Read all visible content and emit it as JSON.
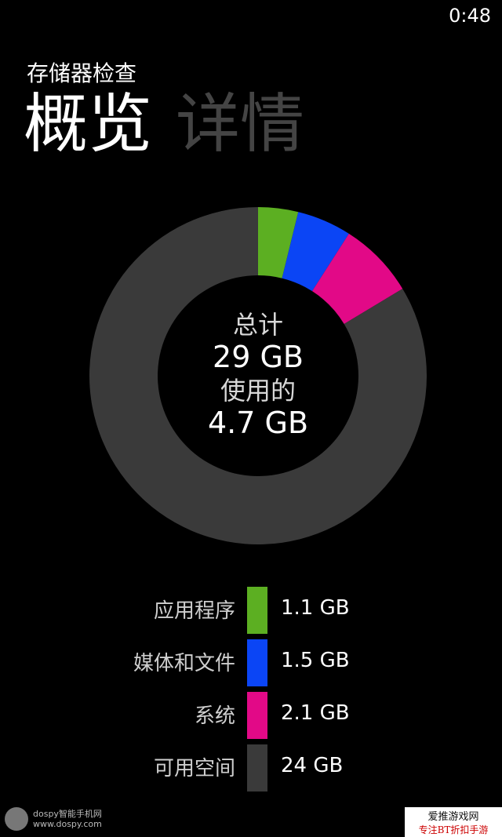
{
  "status_bar": {
    "time": "0:48"
  },
  "app_title": "存储器检查",
  "pivot": {
    "active": "概览",
    "inactive": "详情"
  },
  "donut": {
    "total_label": "总计",
    "total_value": "29 GB",
    "used_label": "使用的",
    "used_value": "4.7 GB"
  },
  "chart_data": {
    "type": "pie",
    "donut": true,
    "segments": [
      {
        "label": "应用程序",
        "value": 1.1,
        "color": "#5CAF22"
      },
      {
        "label": "媒体和文件",
        "value": 1.5,
        "color": "#0B45F5"
      },
      {
        "label": "系统",
        "value": 2.1,
        "color": "#E20987"
      },
      {
        "label": "可用空间",
        "value": 24,
        "color": "#3A3A3A"
      }
    ]
  },
  "legend": [
    {
      "label": "应用程序",
      "value": "1.1 GB",
      "color": "#5CAF22"
    },
    {
      "label": "媒体和文件",
      "value": "1.5 GB",
      "color": "#0B45F5"
    },
    {
      "label": "系统",
      "value": "2.1 GB",
      "color": "#E20987"
    },
    {
      "label": "可用空间",
      "value": "24 GB",
      "color": "#3A3A3A"
    }
  ],
  "watermark_left": {
    "line1": "dospy智能手机网",
    "line2": "www.dospy.com"
  },
  "watermark_right": {
    "line1": "爱推游戏网",
    "line2": "专注BT折扣手游"
  }
}
